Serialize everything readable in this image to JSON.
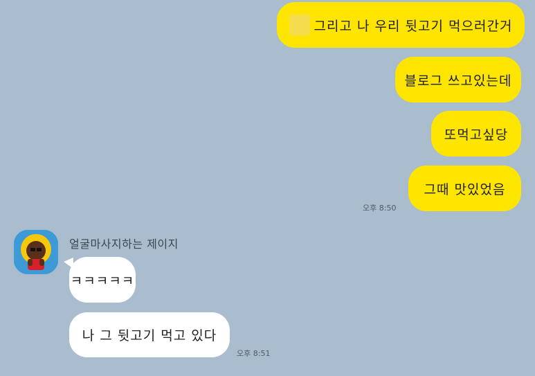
{
  "chat": {
    "messages_me": [
      {
        "text": "그리고 나 우리 뒷고기 먹으러간거"
      },
      {
        "text": "블로그 쓰고있는데"
      },
      {
        "text": "또먹고싶당"
      },
      {
        "text": "그때 맛있었음"
      }
    ],
    "me_time": "오후 8:50",
    "sender_name": "얼굴마사지하는 제이지",
    "messages_them": [
      {
        "text": "ㅋㅋㅋㅋㅋ"
      },
      {
        "text": "나 그 뒷고기 먹고 있다"
      }
    ],
    "them_time": "오후 8:51"
  },
  "colors": {
    "background": "#a9bdce",
    "my_bubble": "#fee500",
    "their_bubble": "#ffffff",
    "avatar_bg": "#3d9ad6"
  }
}
